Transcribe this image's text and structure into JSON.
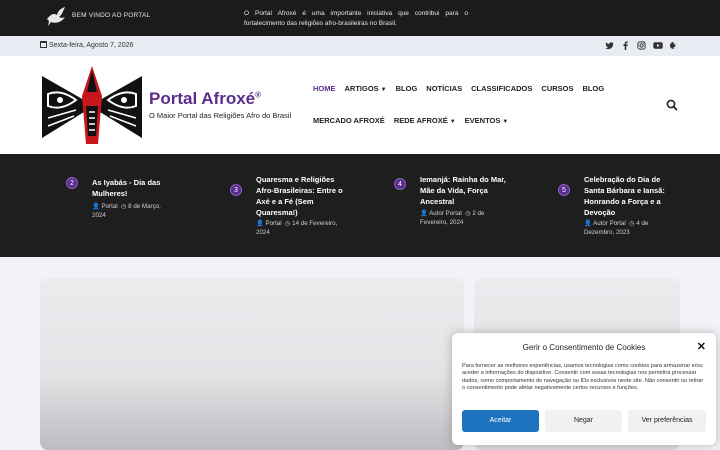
{
  "topbar": {
    "welcome": "BEM VINDO AO PORTAL",
    "intro": "O Portal Afroxé é uma importante iniciativa que contribui para o fortalecimento das religiões afro-brasileiras no Brasil."
  },
  "datebar": {
    "date": "Sexta-feira, Agosto 7, 2026",
    "socials": [
      "twitter-icon",
      "facebook-icon",
      "instagram-icon",
      "youtube-icon",
      "theme-toggle-icon"
    ]
  },
  "header": {
    "brand": "Portal Afroxé",
    "brand_mark": "®",
    "tagline": "O Maior Portal das Religiões Afro do Brasil"
  },
  "nav": {
    "row1": [
      {
        "label": "HOME",
        "dropdown": false
      },
      {
        "label": "ARTIGOS",
        "dropdown": true
      },
      {
        "label": "BLOG",
        "dropdown": false
      },
      {
        "label": "NOTÍCIAS",
        "dropdown": false
      },
      {
        "label": "CLASSIFICADOS",
        "dropdown": false
      },
      {
        "label": "CURSOS",
        "dropdown": false
      },
      {
        "label": "BLOG",
        "dropdown": false
      }
    ],
    "row2": [
      {
        "label": "MERCADO AFROXÉ",
        "dropdown": false
      },
      {
        "label": "REDE AFROXÉ",
        "dropdown": true
      },
      {
        "label": "EVENTOS",
        "dropdown": true
      }
    ]
  },
  "posts": [
    {
      "num": "2",
      "title": "As Iyabás - Dia das Mulheres!",
      "author": "Portal",
      "date": "8 de Março, 2024"
    },
    {
      "num": "3",
      "title": "Quaresma e Religiões Afro-Brasileiras: Entre o Axé e a Fé (Sem Quaresma!)",
      "author": "Portal",
      "date": "14 de Fevereiro, 2024"
    },
    {
      "num": "4",
      "title": "Iemanjá: Rainha do Mar, Mãe da Vida, Força Ancestral",
      "author": "Autor Portal",
      "date": "2 de Fevereiro, 2024"
    },
    {
      "num": "5",
      "title": "Celebração do Dia de Santa Bárbara e Iansã: Honrando a Força e a Devoção",
      "author": "Autor Portal",
      "date": "4 de Dezembro, 2023"
    }
  ],
  "cookie": {
    "title": "Gerir o Consentimento de Cookies",
    "text": "Para fornecer as melhores experiências, usamos tecnologias como cookies para armazenar e/ou aceder a informações do dispositivo. Consentir com essas tecnologias nos permitirá processar dados, como comportamento de navegação ou IDs exclusivos neste site. Não consentir ou retirar o consentimento pode afetar negativamente certos recursos e funções.",
    "accept": "Aceitar",
    "deny": "Negar",
    "preferences": "Ver preferências"
  },
  "colors": {
    "brand": "#5a2d8c",
    "accept": "#1e73be",
    "dark": "#1e1e1e"
  }
}
